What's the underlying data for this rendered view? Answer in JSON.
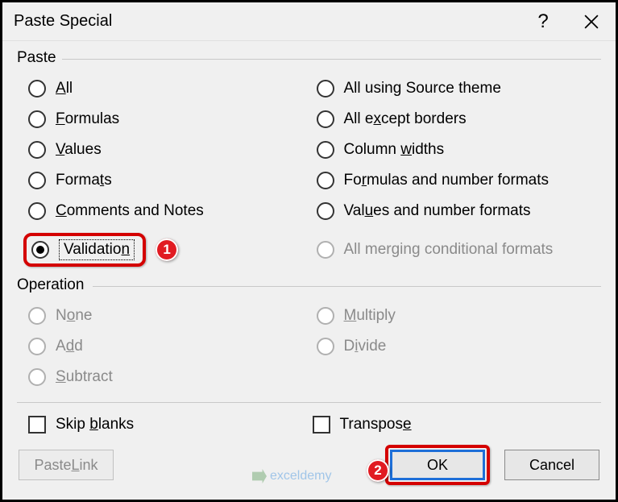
{
  "title": "Paste Special",
  "groups": {
    "paste": "Paste",
    "operation": "Operation"
  },
  "paste_options": {
    "all": "All",
    "formulas": "Formulas",
    "values": "Values",
    "formats": "Formats",
    "comments": "Comments and Notes",
    "validation": "Validation",
    "src_theme": "All using Source theme",
    "except_borders": "All except borders",
    "col_widths": "Column widths",
    "formulas_num": "Formulas and number formats",
    "values_num": "Values and number formats",
    "merge_cond": "All merging conditional formats"
  },
  "operation_options": {
    "none": "None",
    "add": "Add",
    "subtract": "Subtract",
    "multiply": "Multiply",
    "divide": "Divide"
  },
  "checks": {
    "skip_blanks": "Skip blanks",
    "transpose": "Transpose"
  },
  "buttons": {
    "paste_link": "Paste Link",
    "ok": "OK",
    "cancel": "Cancel"
  },
  "callouts": {
    "one": "1",
    "two": "2"
  },
  "watermark": "exceldemy"
}
